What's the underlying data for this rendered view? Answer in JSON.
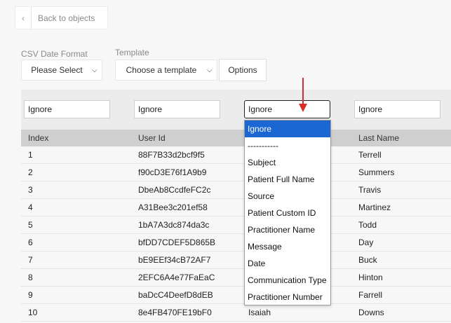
{
  "back": {
    "label": "Back to objects"
  },
  "csv_date_format": {
    "label": "CSV Date Format",
    "value": "Please Select"
  },
  "template": {
    "label": "Template",
    "value": "Choose a template"
  },
  "options_button": {
    "label": "Options"
  },
  "mapping_inputs": [
    "Ignore",
    "Ignore",
    "Ignore",
    "Ignore"
  ],
  "table": {
    "headers": [
      "Index",
      "User Id",
      "",
      "Last Name"
    ],
    "rows": [
      {
        "index": "1",
        "user_id": "88F7B33d2bcf9f5",
        "first": "",
        "last": "Terrell"
      },
      {
        "index": "2",
        "user_id": "f90cD3E76f1A9b9",
        "first": "",
        "last": "Summers"
      },
      {
        "index": "3",
        "user_id": "DbeAb8CcdfeFC2c",
        "first": "",
        "last": "Travis"
      },
      {
        "index": "4",
        "user_id": "A31Bee3c201ef58",
        "first": "",
        "last": "Martinez"
      },
      {
        "index": "5",
        "user_id": "1bA7A3dc874da3c",
        "first": "",
        "last": "Todd"
      },
      {
        "index": "6",
        "user_id": "bfDD7CDEF5D865B",
        "first": "",
        "last": "Day"
      },
      {
        "index": "7",
        "user_id": "bE9EEf34cB72AF7",
        "first": "",
        "last": "Buck"
      },
      {
        "index": "8",
        "user_id": "2EFC6A4e77FaEaC",
        "first": "",
        "last": "Hinton"
      },
      {
        "index": "9",
        "user_id": "baDcC4DeefD8dEB",
        "first": "",
        "last": "Farrell"
      },
      {
        "index": "10",
        "user_id": "8e4FB470FE19bF0",
        "first": "Isaiah",
        "last": "Downs"
      }
    ]
  },
  "dropdown": {
    "selected": "Ignore",
    "options": [
      "Ignore",
      "-----------",
      "Subject",
      "Patient Full Name",
      "Source",
      "Patient Custom ID",
      "Practitioner Name",
      "Message",
      "Date",
      "Communication Type",
      "Practitioner Number"
    ]
  },
  "colors": {
    "selected_option": "#1a66d2",
    "arrow": "#d92b2b"
  }
}
